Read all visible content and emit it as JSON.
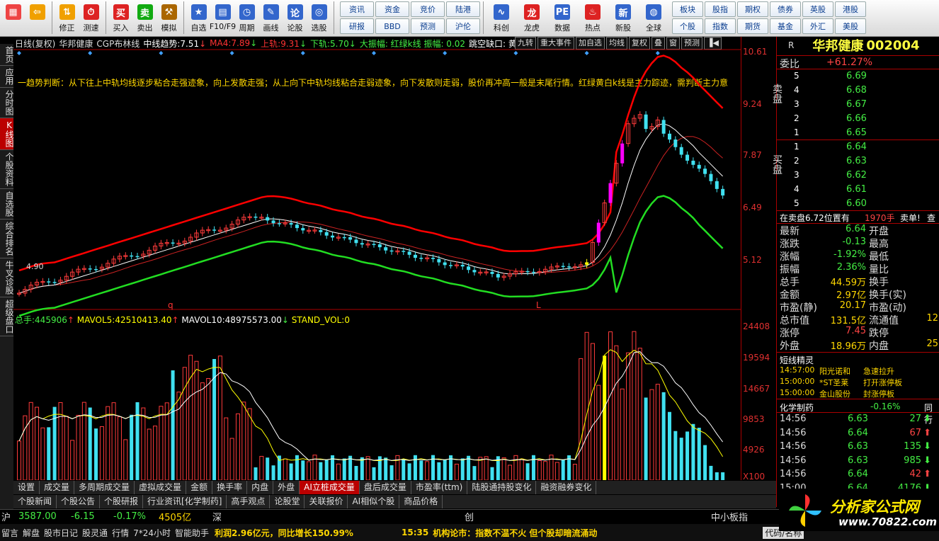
{
  "toolbar": {
    "buttons": [
      {
        "label": "",
        "icon": "grid-icon"
      },
      {
        "label": "",
        "icon": "back-arrow-icon"
      },
      {
        "label": "修正",
        "icon": "fix-icon"
      },
      {
        "label": "测速",
        "icon": "speed-icon"
      },
      {
        "label": "买入",
        "icon": "buy-icon"
      },
      {
        "label": "卖出",
        "icon": "sell-icon"
      },
      {
        "label": "模拟",
        "icon": "hammer-icon"
      },
      {
        "label": "自选",
        "icon": "star-icon"
      },
      {
        "label": "F10/F9",
        "icon": "f10-icon"
      },
      {
        "label": "周期",
        "icon": "period-icon"
      },
      {
        "label": "画线",
        "icon": "pencil-icon"
      },
      {
        "label": "论股",
        "icon": "discuss-icon"
      },
      {
        "label": "选股",
        "icon": "select-icon"
      }
    ],
    "grid1": [
      "资讯",
      "资金",
      "竞价",
      "陆港",
      "研报",
      "BBD",
      "预测",
      "沪伦"
    ],
    "mid_buttons": [
      {
        "label": "科创",
        "icon": "chart-icon"
      },
      {
        "label": "龙虎",
        "icon": "dragon-icon"
      },
      {
        "label": "数据",
        "icon": "pe-icon"
      },
      {
        "label": "热点",
        "icon": "hot-icon"
      },
      {
        "label": "新股",
        "icon": "new-icon"
      },
      {
        "label": "全球",
        "icon": "globe-icon"
      }
    ],
    "grid2": [
      "板块",
      "股指",
      "期权",
      "债券",
      "英股",
      "港股",
      "个股",
      "指数",
      "期货",
      "基金",
      "外汇",
      "美股"
    ]
  },
  "left_tabs": [
    {
      "label": "首页",
      "active": false
    },
    {
      "label": "应用",
      "active": false
    },
    {
      "label": "分时图",
      "active": false
    },
    {
      "label": "K线图",
      "active": true
    },
    {
      "label": "个股资料",
      "active": false
    },
    {
      "label": "自选股",
      "active": false
    },
    {
      "label": "综合排名",
      "active": false
    },
    {
      "label": "牛叉诊股",
      "active": false
    },
    {
      "label": "超级盘口",
      "active": false
    }
  ],
  "chart_header": {
    "period": "日线(复权)",
    "name": "华邦健康",
    "indicator": "CGP布林线",
    "mid_label": "中线趋势:",
    "mid_value": "7.51",
    "ma4_label": "MA4:",
    "ma4_value": "7.89",
    "up_label": "上轨:",
    "up_value": "9.31",
    "down_label": "下轨:",
    "down_value": "5.70",
    "extra": "大振幅: 红绿k线 振幅: 0.02",
    "gap": "跳空缺口: 黄",
    "tools": [
      "九转",
      "重大事件",
      "加自选",
      "均线",
      "复权",
      "叠",
      "窗",
      "预测"
    ]
  },
  "trend_text": "一趋势判断：从下往上中轨均线逐步粘合走强迹象，向上发散走强；从上向下中轨均线粘合走弱迹象，向下发散则走弱，股价再冲高一般是末尾行情。红绿黄白k线是主力踪迹，需判断主力意",
  "price_axis": [
    "10.61",
    "9.24",
    "7.87",
    "6.49",
    "5.12"
  ],
  "vol_axis": [
    "24408",
    "19594",
    "14667",
    "9853",
    "4926",
    "X100"
  ],
  "low_label": "4.90",
  "markers": {
    "q": "q",
    "L": "L"
  },
  "vol_header": {
    "total_label": "总手:",
    "total": "445906",
    "mavol5_label": "MAVOL5:",
    "mavol5": "42510413.40",
    "mavol10_label": "MAVOL10:",
    "mavol10": "48975573.00",
    "std_label": "STAND_VOL:",
    "std": "0"
  },
  "quote": {
    "r": "R",
    "name": "华邦健康",
    "code": "002004",
    "weibi_label": "委比",
    "weibi": "+61.27%",
    "sell_label": "卖盘",
    "buy_label": "买盘",
    "asks": [
      {
        "level": "5",
        "price": "6.69"
      },
      {
        "level": "4",
        "price": "6.68"
      },
      {
        "level": "3",
        "price": "6.67"
      },
      {
        "level": "2",
        "price": "6.66"
      },
      {
        "level": "1",
        "price": "6.65"
      }
    ],
    "bids": [
      {
        "level": "1",
        "price": "6.64"
      },
      {
        "level": "2",
        "price": "6.63"
      },
      {
        "level": "3",
        "price": "6.62"
      },
      {
        "level": "4",
        "price": "6.61"
      },
      {
        "level": "5",
        "price": "6.60"
      }
    ],
    "order_line": "在卖盘6.72位置有",
    "order_qty": "1970手",
    "order_action": "卖单!",
    "order_view": "查",
    "stats": [
      {
        "k": "最新",
        "v": "6.64",
        "k2": "开盘",
        "v2": ""
      },
      {
        "k": "涨跌",
        "v": "-0.13",
        "k2": "最高",
        "v2": ""
      },
      {
        "k": "涨幅",
        "v": "-1.92%",
        "k2": "最低",
        "v2": ""
      },
      {
        "k": "振幅",
        "v": "2.36%",
        "k2": "量比",
        "v2": ""
      },
      {
        "k": "总手",
        "v": "44.59万",
        "k2": "换手",
        "v2": ""
      },
      {
        "k": "金额",
        "v": "2.97亿",
        "k2": "换手(实)",
        "v2": ""
      },
      {
        "k": "市盈(静)",
        "v": "20.17",
        "k2": "市盈(动)",
        "v2": ""
      },
      {
        "k": "总市值",
        "v": "131.5亿",
        "k2": "流通值",
        "v2": "12"
      },
      {
        "k": "涨停",
        "v": "7.45",
        "k2": "跌停",
        "v2": ""
      },
      {
        "k": "外盘",
        "v": "18.96万",
        "k2": "内盘",
        "v2": "25"
      }
    ],
    "elf_title": "短线精灵",
    "elf": [
      {
        "time": "14:57:00",
        "name": "阳光诺和",
        "event": "急速拉升"
      },
      {
        "time": "15:00:00",
        "name": "*ST圣莱",
        "event": "打开涨停板"
      },
      {
        "time": "15:00:00",
        "name": "金山股份",
        "event": "封涨停板"
      }
    ],
    "sector": "化学制药",
    "sector_pct": "-0.16%",
    "sector_more": "同行",
    "ticks": [
      {
        "t": "14:56",
        "p": "6.63",
        "v": "27",
        "dir": "down"
      },
      {
        "t": "14:56",
        "p": "6.64",
        "v": "67",
        "dir": "up"
      },
      {
        "t": "14:56",
        "p": "6.63",
        "v": "135",
        "dir": "down"
      },
      {
        "t": "14:56",
        "p": "6.63",
        "v": "985",
        "dir": "down"
      },
      {
        "t": "14:56",
        "p": "6.64",
        "v": "42",
        "dir": "up"
      },
      {
        "t": "15:00",
        "p": "6.64",
        "v": "4176",
        "dir": "down"
      }
    ]
  },
  "bottom_tabs": [
    "设置",
    "成交量",
    "多周期成交量",
    "虚拟成交量",
    "金额",
    "换手率",
    "内盘",
    "外盘",
    "AI立桩成交量",
    "盘后成交量",
    "市盈率(ttm)",
    "陆股通持股变化",
    "融资融券变化"
  ],
  "bottom_tabs2": [
    "个股新闻",
    "个股公告",
    "个股研报",
    "行业资讯[化学制药]",
    "高手观点",
    "论股堂",
    "关联报价",
    "AI相似个股",
    "商品价格"
  ],
  "index_bar": {
    "sh": "沪",
    "sh_val": "3587.00",
    "sh_chg": "-6.15",
    "sh_pct": "-0.17%",
    "sh_amt": "4505亿",
    "sz": "深",
    "cy": "创",
    "zx": "中小板指"
  },
  "status": {
    "items": [
      "留言",
      "解盘",
      "股市日记",
      "股灵通",
      "行情",
      "7*24小时",
      "智能助手"
    ],
    "profit": "利润2.96亿元，同比增长150.99%",
    "news_time": "15:35",
    "news": "机构论市：指数不温不火 但个股却暗流涌动",
    "code_label": "代码/名称"
  },
  "logo": {
    "text": "分析家公式网",
    "url": "www.70822.com"
  },
  "colors": {
    "up": "#ff3b3b",
    "down": "#40e0f0",
    "boll_up": "#ff0000",
    "boll_mid": "#ffffff",
    "boll_low": "#22dd22",
    "ma": "#cc2222",
    "magenta": "#ff00ff",
    "yellow": "#ffff00"
  }
}
